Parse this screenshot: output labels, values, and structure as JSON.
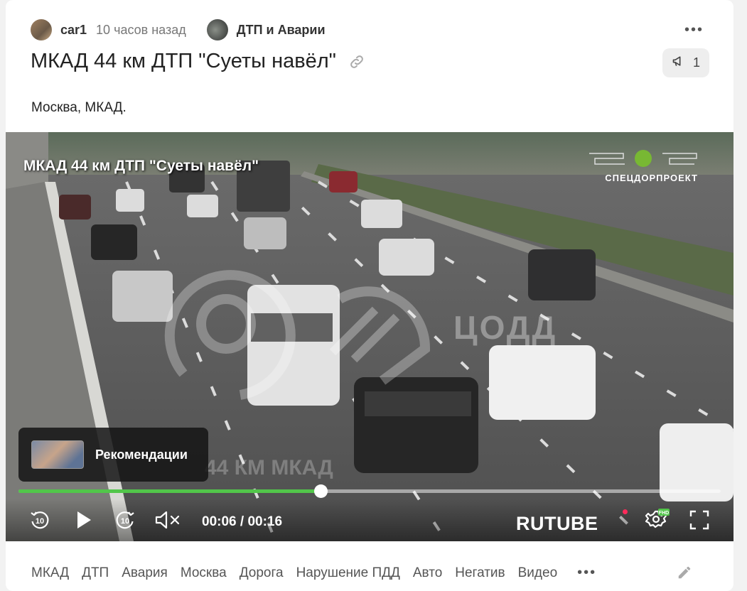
{
  "post": {
    "author": "car1",
    "time_ago": "10 часов назад",
    "community": "ДТП и Аварии",
    "title": "МКАД 44 км ДТП \"Суеты навёл\"",
    "rating_count": "1",
    "body_text": "Москва, МКАД."
  },
  "video": {
    "overlay_title": "МКАД 44 км ДТП \"Суеты навёл\"",
    "top_logo_text": "СПЕЦДОРПРОЕКТ",
    "watermark_text": "ЦОДД",
    "overlay_location": "44 КМ МКАД",
    "recommendations_label": "Рекомендации",
    "current_time": "00:06",
    "duration": "00:16",
    "time_separator": "/",
    "progress_fraction": 0.43,
    "rewind_seconds": "10",
    "forward_seconds": "10",
    "brand": "RUTUBE",
    "quality_badge": "FHD",
    "colors": {
      "progress": "#52c64a",
      "brand_dot": "#ff2a5a"
    },
    "icons": [
      "rewind-10-icon",
      "play-icon",
      "forward-10-icon",
      "mute-icon",
      "settings-gear-icon",
      "fullscreen-icon"
    ]
  },
  "tags": [
    "МКАД",
    "ДТП",
    "Авария",
    "Москва",
    "Дорога",
    "Нарушение ПДД",
    "Авто",
    "Негатив",
    "Видео"
  ],
  "icons": {
    "more": "more-dots-icon",
    "link": "link-icon",
    "rating": "megaphone-icon",
    "edit": "pencil-icon"
  }
}
